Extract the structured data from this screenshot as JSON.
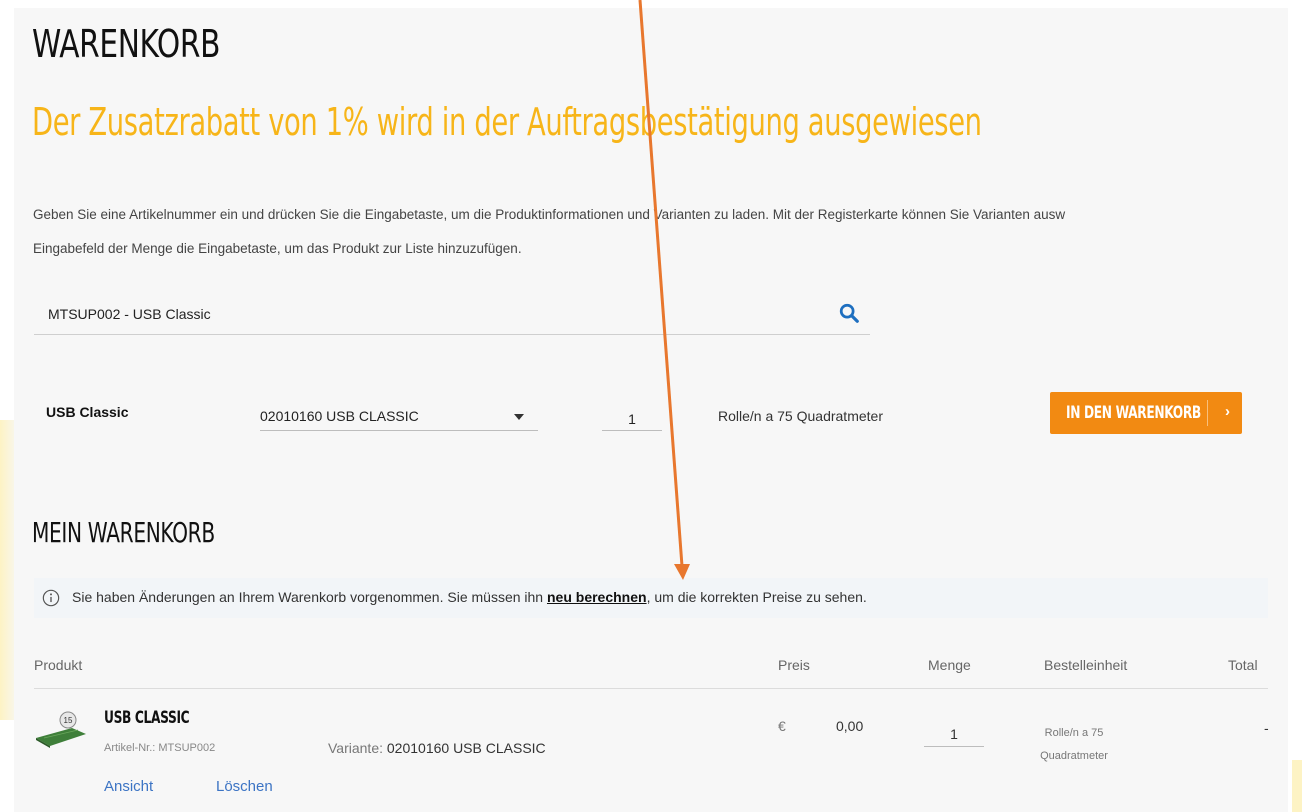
{
  "header": {
    "title": "WARENKORB",
    "subtitle": "Der Zusatzrabatt von 1% wird in der Auftragsbestätigung ausgewiesen"
  },
  "instructions": {
    "line1": "Geben Sie eine Artikelnummer ein und drücken Sie die Eingabetaste, um die Produktinformationen und Varianten zu laden. Mit der Registerkarte können Sie Varianten ausw",
    "line2": "Eingabefeld der Menge die Eingabetaste, um das Produkt zur Liste hinzuzufügen."
  },
  "search": {
    "value": "MTSUP002 - USB Classic",
    "icon": "search-icon"
  },
  "quick_add": {
    "product_name": "USB Classic",
    "variant_selected": "02010160 USB CLASSIC",
    "quantity": "1",
    "unit": "Rolle/n a 75 Quadratmeter",
    "button_label": "IN DEN WARENKORB",
    "button_chevron": "›"
  },
  "cart": {
    "heading": "MEIN WARENKORB",
    "notice": {
      "icon": "info-icon",
      "text_before": "Sie haben Änderungen an Ihrem Warenkorb vorgenommen. Sie müssen ihn ",
      "link": "neu berechnen",
      "text_after": ", um die korrekten Preise zu sehen."
    },
    "columns": {
      "product": "Produkt",
      "price": "Preis",
      "quantity": "Menge",
      "unit": "Bestelleinheit",
      "total": "Total"
    },
    "items": [
      {
        "name": "USB CLASSIC",
        "sku": "Artikel-Nr.: MTSUP002",
        "variant_label": "Variante: ",
        "variant_value": "02010160 USB CLASSIC",
        "currency": "€",
        "price": "0,00",
        "quantity": "1",
        "unit": "Rolle/n a 75 Quadratmeter",
        "total": "-",
        "view_label": "Ansicht",
        "delete_label": "Löschen",
        "thumbnail_badge": "15"
      }
    ]
  },
  "colors": {
    "accent_yellow": "#f7b519",
    "button_orange": "#f28a12",
    "link_blue": "#3c74c4",
    "arrow_orange": "#e8772e",
    "search_icon_blue": "#1e6fc0"
  }
}
